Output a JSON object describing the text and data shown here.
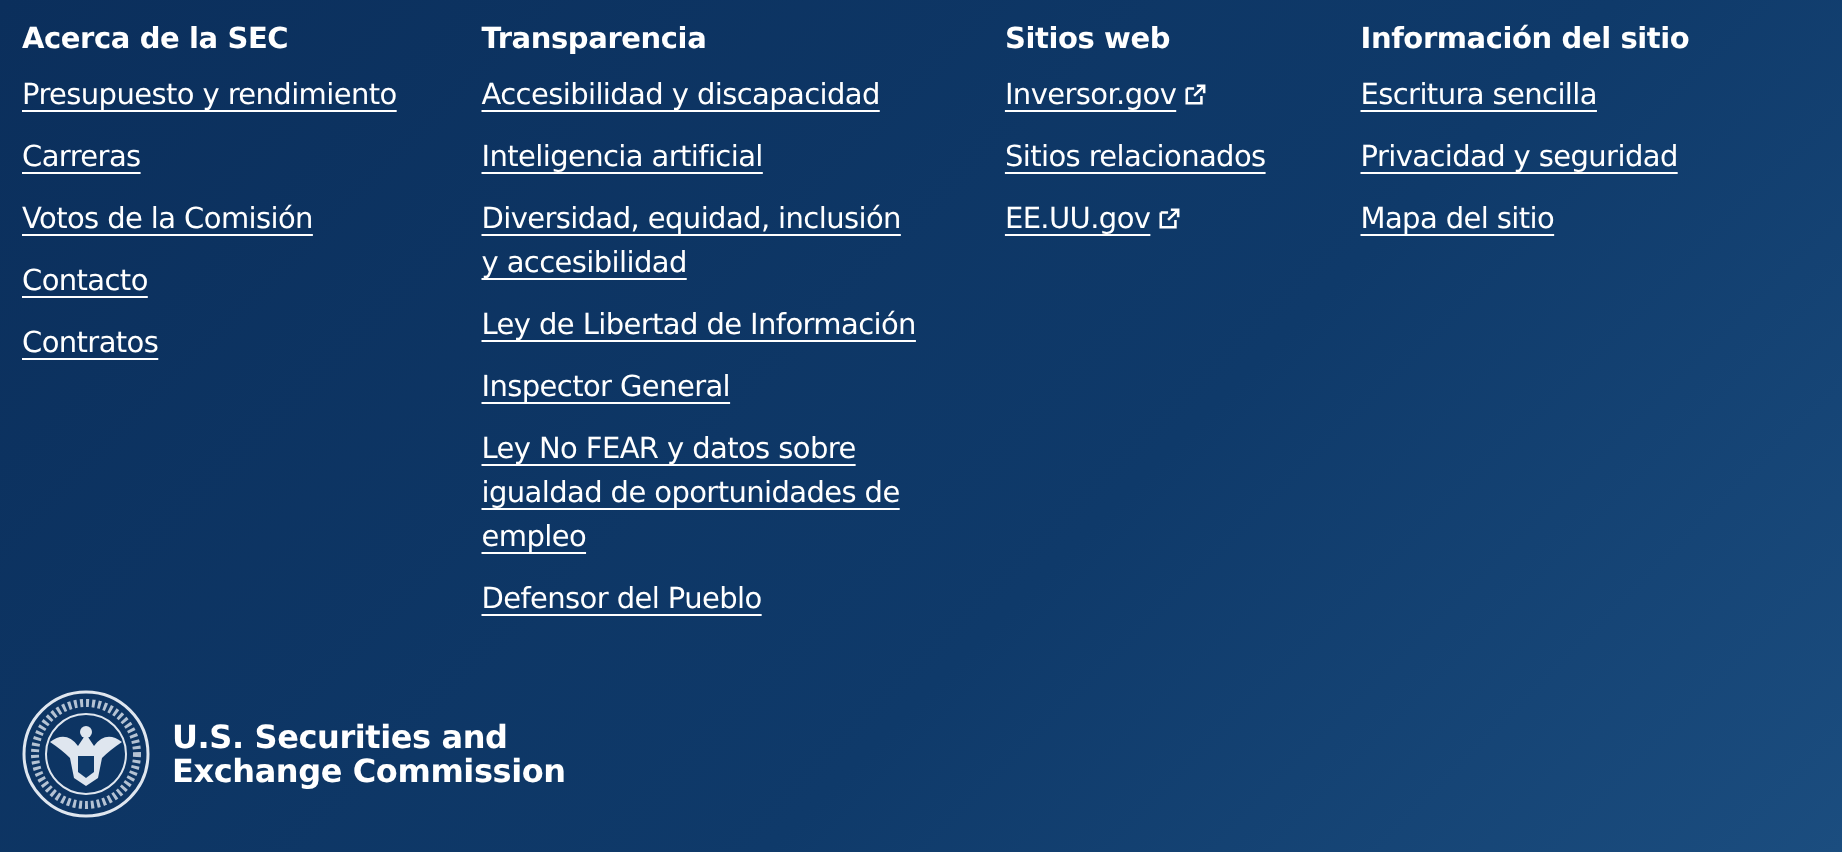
{
  "columns": [
    {
      "heading": "Acerca de la SEC",
      "links": [
        {
          "label": "Presupuesto y rendimiento",
          "external": false
        },
        {
          "label": "Carreras",
          "external": false
        },
        {
          "label": "Votos de la Comisión",
          "external": false
        },
        {
          "label": "Contacto",
          "external": false
        },
        {
          "label": "Contratos",
          "external": false
        }
      ]
    },
    {
      "heading": "Transparencia",
      "links": [
        {
          "label": "Accesibilidad y discapacidad",
          "external": false
        },
        {
          "label": "Inteligencia artificial",
          "external": false
        },
        {
          "label": "Diversidad, equidad, inclusión y accesibilidad",
          "external": false
        },
        {
          "label": "Ley de Libertad de Información",
          "external": false
        },
        {
          "label": "Inspector General",
          "external": false
        },
        {
          "label": "Ley No FEAR y datos sobre igualdad de oportunidades de empleo",
          "external": false
        },
        {
          "label": "Defensor del Pueblo",
          "external": false
        }
      ]
    },
    {
      "heading": "Sitios web",
      "links": [
        {
          "label": "Inversor.gov",
          "external": true
        },
        {
          "label": "Sitios relacionados",
          "external": false
        },
        {
          "label": "EE.UU.gov",
          "external": true
        }
      ]
    },
    {
      "heading": "Información del sitio",
      "links": [
        {
          "label": "Escritura sencilla",
          "external": false
        },
        {
          "label": "Privacidad y seguridad",
          "external": false
        },
        {
          "label": "Mapa del sitio",
          "external": false
        }
      ]
    }
  ],
  "logo": {
    "lines": [
      "U.S. Securities and",
      "Exchange Commission"
    ]
  }
}
